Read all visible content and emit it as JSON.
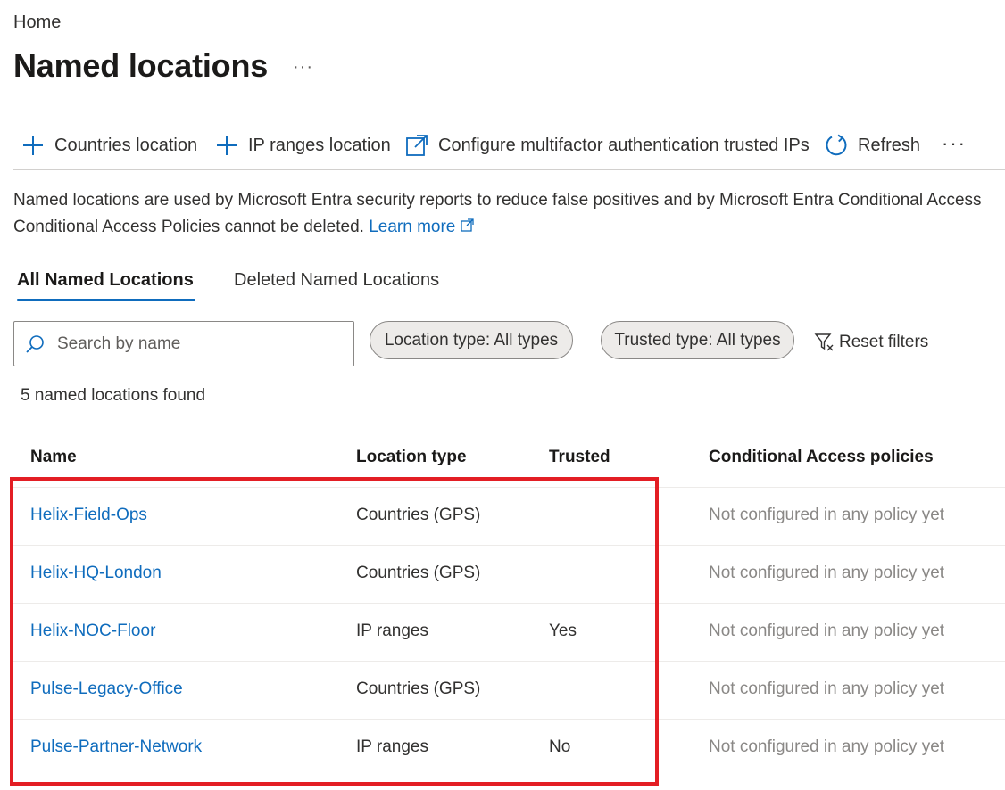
{
  "breadcrumb": "Home",
  "page_title": "Named locations",
  "title_more": "···",
  "toolbar": {
    "countries_location": "Countries location",
    "ip_ranges_location": "IP ranges location",
    "configure_mfa": "Configure multifactor authentication trusted IPs",
    "refresh": "Refresh",
    "more": "···"
  },
  "description": {
    "line1": "Named locations are used by Microsoft Entra security reports to reduce false positives and by Microsoft Entra Conditional Access",
    "line2": "Conditional Access Policies cannot be deleted.",
    "learn_more": "Learn more"
  },
  "tabs": [
    {
      "label": "All Named Locations",
      "active": true
    },
    {
      "label": "Deleted Named Locations",
      "active": false
    }
  ],
  "search": {
    "placeholder": "Search by name",
    "value": ""
  },
  "filters": {
    "location_type": "Location type: All types",
    "trusted_type": "Trusted type: All types",
    "reset": "Reset filters"
  },
  "results_count": "5 named locations found",
  "table": {
    "headers": [
      "Name",
      "Location type",
      "Trusted",
      "Conditional Access policies"
    ],
    "rows": [
      {
        "name": "Helix-Field-Ops",
        "location_type": "Countries (GPS)",
        "trusted": "",
        "policies": "Not configured in any policy yet"
      },
      {
        "name": "Helix-HQ-London",
        "location_type": "Countries (GPS)",
        "trusted": "",
        "policies": "Not configured in any policy yet"
      },
      {
        "name": "Helix-NOC-Floor",
        "location_type": "IP ranges",
        "trusted": "Yes",
        "policies": "Not configured in any policy yet"
      },
      {
        "name": "Pulse-Legacy-Office",
        "location_type": "Countries (GPS)",
        "trusted": "",
        "policies": "Not configured in any policy yet"
      },
      {
        "name": "Pulse-Partner-Network",
        "location_type": "IP ranges",
        "trusted": "No",
        "policies": "Not configured in any policy yet"
      }
    ]
  },
  "colors": {
    "accent": "#0f6cbd",
    "highlight": "#e31e24",
    "muted": "#8a8886"
  },
  "icons": [
    "plus-icon",
    "external-link-icon",
    "refresh-icon",
    "search-icon",
    "filter-reset-icon"
  ]
}
